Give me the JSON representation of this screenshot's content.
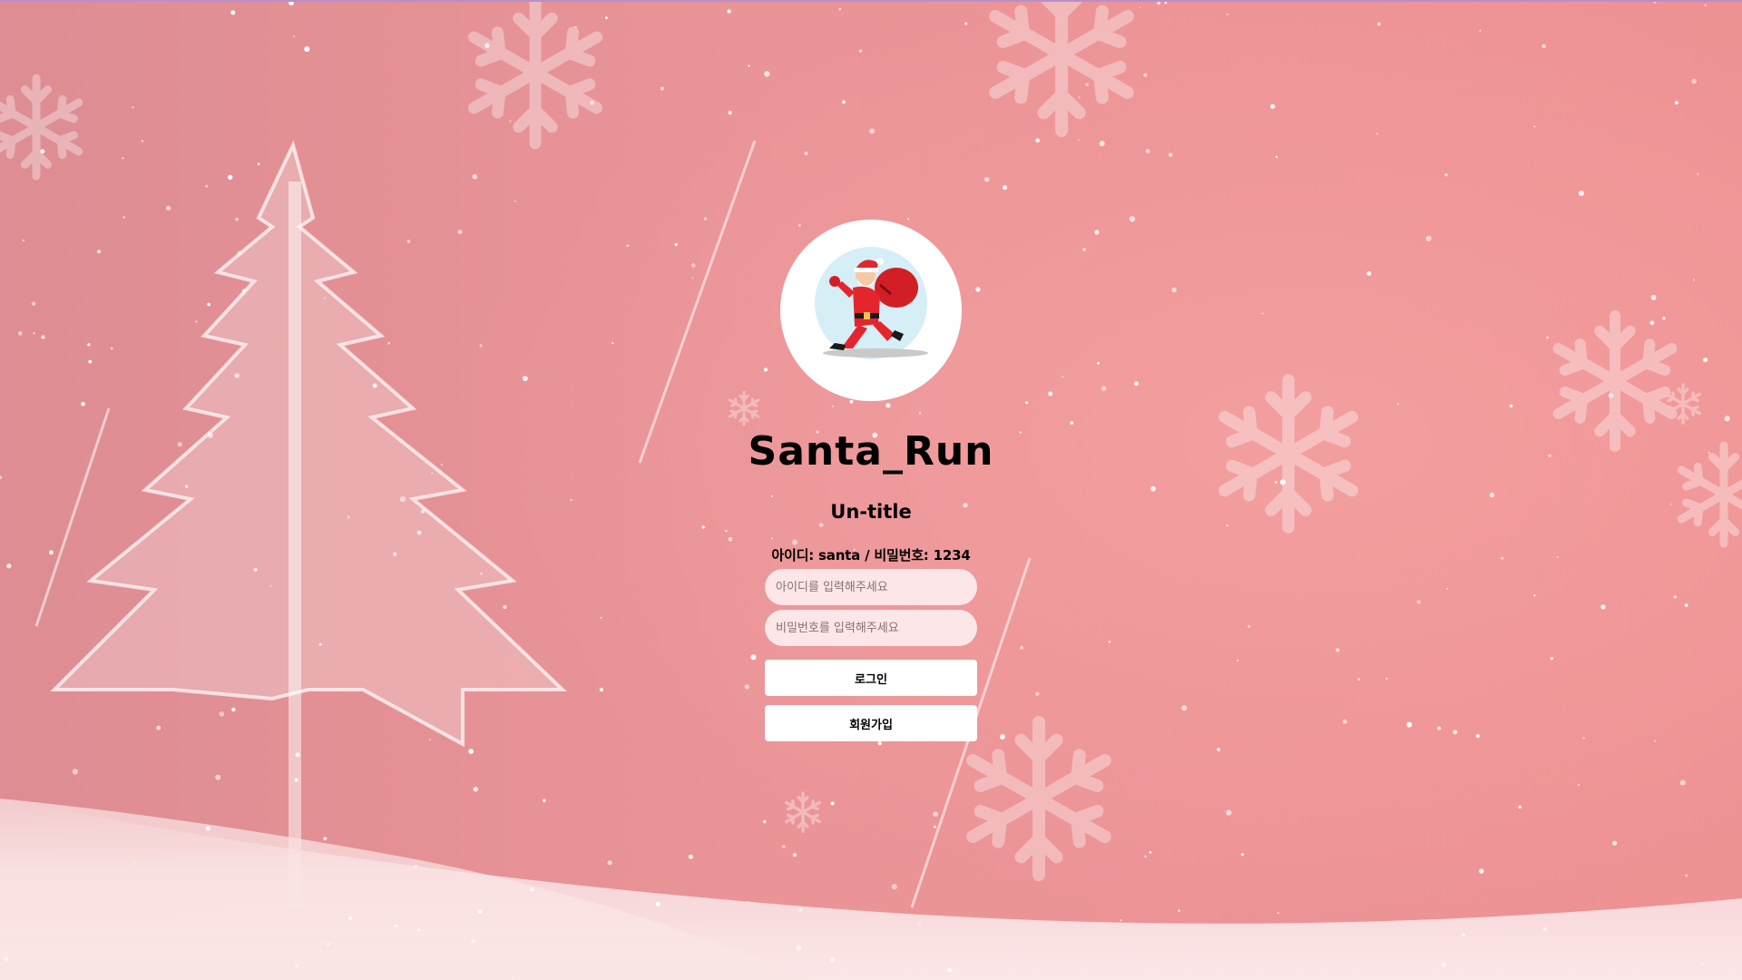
{
  "app": {
    "title": "Santa_Run",
    "subtitle": "Un-title",
    "credential_hint": "아이디: santa / 비밀번호: 1234"
  },
  "login_form": {
    "id_placeholder": "아이디를 입력해주세요",
    "password_placeholder": "비밀번호를 입력해주세요",
    "login_label": "로그인",
    "signup_label": "회원가입"
  },
  "colors": {
    "background": "#e88f94",
    "input_background": "#fde6e7",
    "button_background": "#ffffff",
    "santa_red": "#e3262d"
  },
  "icons": {
    "avatar": "santa-running-with-sack-icon",
    "background": "snowy-christmas-tree-and-snowflakes"
  }
}
